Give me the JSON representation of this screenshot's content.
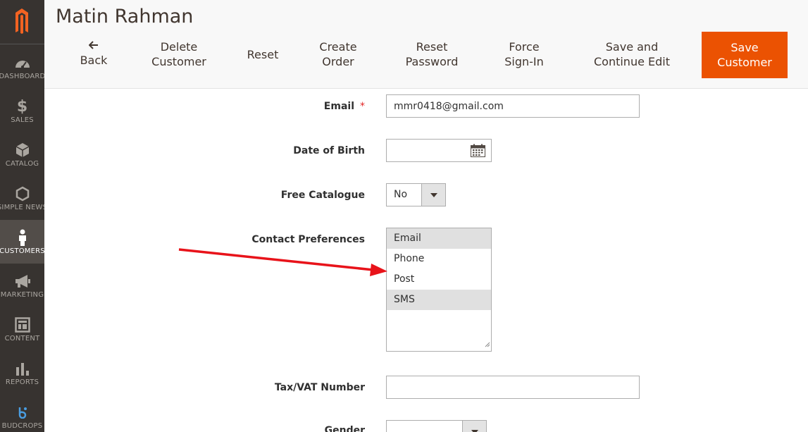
{
  "sidebar": {
    "items": [
      {
        "label": "DASHBOARD",
        "icon": "gauge-icon"
      },
      {
        "label": "SALES",
        "icon": "dollar-icon"
      },
      {
        "label": "CATALOG",
        "icon": "cube-icon"
      },
      {
        "label": "SIMPLE NEWS",
        "icon": "hexagon-icon"
      },
      {
        "label": "CUSTOMERS",
        "icon": "person-icon",
        "active": true
      },
      {
        "label": "MARKETING",
        "icon": "megaphone-icon"
      },
      {
        "label": "CONTENT",
        "icon": "layout-icon"
      },
      {
        "label": "REPORTS",
        "icon": "bar-chart-icon"
      },
      {
        "label": "BUDCROPS",
        "icon": "budcrops-icon"
      }
    ]
  },
  "header": {
    "title": "Matin Rahman",
    "buttons": {
      "back": "Back",
      "delete_l1": "Delete",
      "delete_l2": "Customer",
      "reset": "Reset",
      "create_l1": "Create",
      "create_l2": "Order",
      "reset_pw_l1": "Reset",
      "reset_pw_l2": "Password",
      "force_l1": "Force",
      "force_l2": "Sign-In",
      "save_cont_l1": "Save and",
      "save_cont_l2": "Continue Edit",
      "save_l1": "Save",
      "save_l2": "Customer"
    }
  },
  "form": {
    "email": {
      "label": "Email",
      "required_mark": "*",
      "value": "mmr0418@gmail.com"
    },
    "dob": {
      "label": "Date of Birth",
      "value": ""
    },
    "free_catalogue": {
      "label": "Free Catalogue",
      "value": "No"
    },
    "contact_preferences": {
      "label": "Contact Preferences",
      "options": [
        {
          "label": "Email",
          "selected": true
        },
        {
          "label": "Phone",
          "selected": false
        },
        {
          "label": "Post",
          "selected": false
        },
        {
          "label": "SMS",
          "selected": true
        }
      ]
    },
    "taxvat": {
      "label": "Tax/VAT Number",
      "value": ""
    },
    "gender": {
      "label": "Gender",
      "value": ""
    }
  },
  "colors": {
    "accent": "#eb5202",
    "sidebar_bg": "#373330",
    "annotation_arrow": "#e8131a"
  }
}
